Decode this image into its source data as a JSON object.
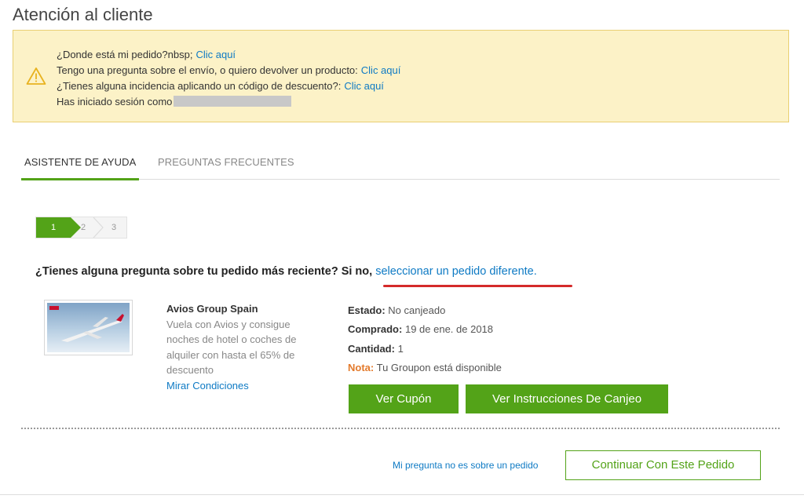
{
  "page": {
    "title": "Atención al cliente"
  },
  "notice": {
    "line1_text": "¿Donde está mi pedido?nbsp;",
    "line1_link": "Clic aquí",
    "line2_text": "Tengo una pregunta sobre el envío, o quiero devolver un producto:",
    "line2_link": "Clic aquí",
    "line3_text": "¿Tienes alguna incidencia aplicando un código de descuento?:",
    "line3_link": "Clic aquí",
    "line4_text": "Has iniciado sesión como",
    "icon": "warning-icon",
    "colors": {
      "background": "#fcf2c7",
      "border": "#e9cf72"
    }
  },
  "tabs": [
    {
      "label": "ASISTENTE DE AYUDA",
      "active": true
    },
    {
      "label": "PREGUNTAS FRECUENTES",
      "active": false
    }
  ],
  "stepper": {
    "steps": [
      "1",
      "2",
      "3"
    ],
    "current": 1
  },
  "question": {
    "text": "¿Tienes alguna pregunta sobre tu pedido más reciente? Si no,",
    "link": "seleccionar un pedido diferente."
  },
  "order": {
    "deal_title": "Avios Group Spain",
    "deal_description": "Vuela con Avios y consigue noches de hotel o coches de alquiler con hasta el 65% de descuento",
    "terms_link": "Mirar Condiciones",
    "estado_label": "Estado:",
    "estado_value": "No canjeado",
    "comprado_label": "Comprado:",
    "comprado_value": "19 de ene. de 2018",
    "cantidad_label": "Cantidad:",
    "cantidad_value": "1",
    "nota_label": "Nota:",
    "nota_value": "Tu Groupon está disponible"
  },
  "buttons": {
    "coupon": "Ver Cupón",
    "instructions": "Ver Instrucciones De Canjeo",
    "not_order": "Mi pregunta no es sobre un pedido",
    "continue": "Continuar Con Este Pedido"
  },
  "colors": {
    "accent": "#53a318",
    "link": "#0e7ac4",
    "highlight": "#d42a2a",
    "note": "#e37a2c"
  }
}
